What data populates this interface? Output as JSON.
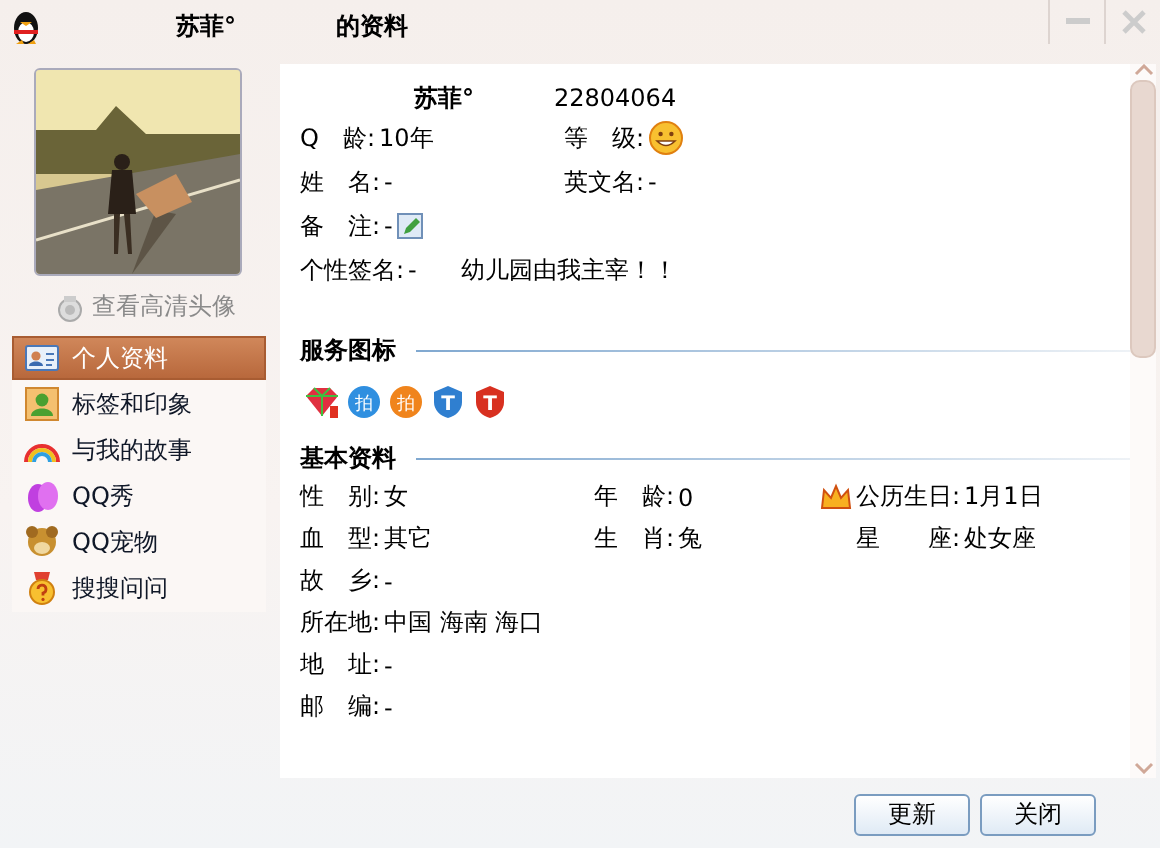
{
  "window": {
    "title_name": "苏菲°",
    "title_suffix": "的资料"
  },
  "avatar": {
    "kind": "picture",
    "link": "查看高清头像"
  },
  "nav": [
    {
      "label": "个人资料",
      "selected": true
    },
    {
      "label": "标签和印象",
      "selected": false
    },
    {
      "label": "与我的故事",
      "selected": false
    },
    {
      "label": "QQ秀",
      "selected": false
    },
    {
      "label": "QQ宠物",
      "selected": false
    },
    {
      "label": "搜搜问问",
      "selected": false
    }
  ],
  "profile": {
    "nickname": "苏菲°",
    "qq": "22804064",
    "rows": [
      [
        {
          "label": "Q　龄:",
          "value": "10年"
        },
        {
          "label": "等　级:",
          "kind": "level"
        }
      ],
      [
        {
          "label": "姓　名:",
          "value": "-"
        },
        {
          "label": "英文名:",
          "value": "-"
        }
      ],
      [
        {
          "label": "备　注:",
          "value": "-",
          "kind": "remark"
        }
      ],
      [
        {
          "label": "个性签名:",
          "value": "-"
        },
        {
          "kind": "signature",
          "value": "幼儿园由我主宰！！"
        }
      ]
    ]
  },
  "services": {
    "title": "服务图标",
    "icons": [
      {
        "kind": "gem"
      },
      {
        "kind": "badge",
        "color": "#2f8fe0",
        "glyph": "拍"
      },
      {
        "kind": "badge",
        "color": "#f0841c",
        "glyph": "拍"
      },
      {
        "kind": "shield",
        "color": "#2f7fd0",
        "glyph": "T"
      },
      {
        "kind": "shield",
        "color": "#d83020",
        "glyph": "T"
      }
    ]
  },
  "basic": {
    "title": "基本资料",
    "rows": [
      [
        {
          "label": "性　别:",
          "value": "女"
        },
        {
          "label": "年　龄:",
          "value": "0"
        },
        {
          "label": "公历生日:",
          "value": "1月1日",
          "kind": "birthday"
        }
      ],
      [
        {
          "label": "血　型:",
          "value": "其它"
        },
        {
          "label": "生　肖:",
          "value": "兔"
        },
        {
          "label": "星　　座:",
          "value": "处女座"
        }
      ],
      [
        {
          "label": "故　乡:",
          "value": "-"
        }
      ],
      [
        {
          "label": "所在地:",
          "value": "中国 海南 海口"
        }
      ],
      [
        {
          "label": "地　址:",
          "value": "-"
        }
      ],
      [
        {
          "label": "邮　编:",
          "value": "-"
        }
      ]
    ]
  },
  "buttons": [
    {
      "label": "更新"
    },
    {
      "label": "关闭"
    }
  ]
}
